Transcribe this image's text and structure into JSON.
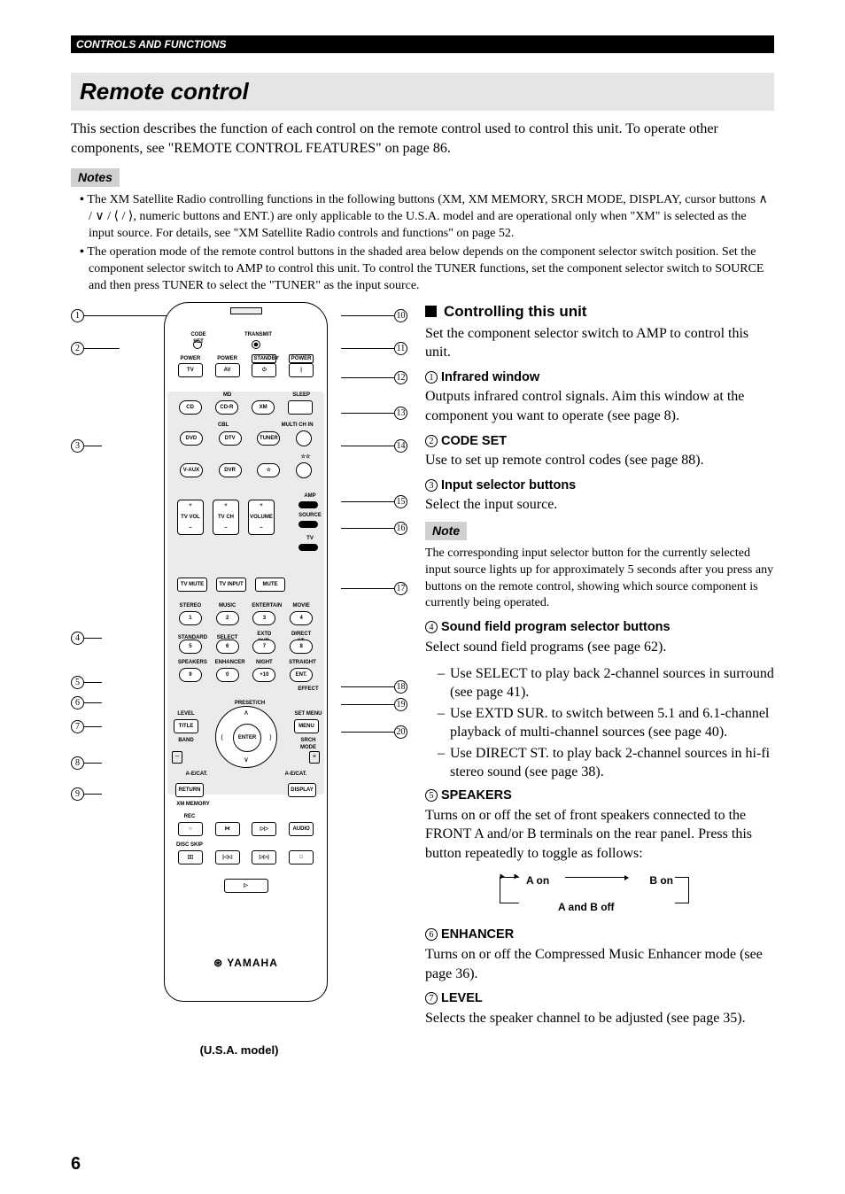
{
  "header_bar": "CONTROLS AND FUNCTIONS",
  "title": "Remote control",
  "intro": "This section describes the function of each control on the remote control used to control this unit. To operate other components, see \"REMOTE CONTROL FEATURES\" on page 86.",
  "notes_label": "Notes",
  "notes": [
    "The XM Satellite Radio controlling functions in the following buttons (XM, XM MEMORY, SRCH MODE, DISPLAY, cursor buttons ∧ / ∨ / ⟨ / ⟩, numeric buttons and ENT.) are only applicable to the U.S.A. model and are operational only when \"XM\" is selected as the input source. For details, see \"XM Satellite Radio controls and functions\" on page 52.",
    "The operation mode of the remote control buttons in the shaded area below depends on the component selector switch position. Set the component selector switch to AMP to control this unit. To control the TUNER functions, set the component selector switch to SOURCE and then press TUNER to select the \"TUNER\" as the input source."
  ],
  "remote": {
    "ir": "",
    "row_codeset": {
      "l": "CODE SET",
      "r": "TRANSMIT"
    },
    "row_power_hdr": [
      "POWER",
      "POWER",
      "STANDBY",
      "POWER"
    ],
    "row_power": [
      "TV",
      "AV",
      "⏻",
      "|"
    ],
    "row_src1_hdr": [
      "",
      "MD",
      "",
      "SLEEP"
    ],
    "row_src1": [
      "CD",
      "CD-R",
      "XM",
      ""
    ],
    "row_src2_hdr": [
      "",
      "CBL",
      "",
      "MULTI CH IN"
    ],
    "row_src2": [
      "DVD",
      "DTV",
      "TUNER",
      ""
    ],
    "row_src3": [
      "V-AUX",
      "DVR",
      "☆",
      ""
    ],
    "row_src3_icon": "☆☆",
    "sel_labels": [
      "AMP",
      "SOURCE",
      "TV"
    ],
    "big_btns": [
      {
        "top": "+",
        "mid": "TV VOL",
        "bot": "–"
      },
      {
        "top": "+",
        "mid": "TV CH",
        "bot": "–"
      },
      {
        "top": "+",
        "mid": "VOLUME",
        "bot": "–"
      }
    ],
    "row_mute": [
      "TV MUTE",
      "TV INPUT",
      "MUTE"
    ],
    "sf_headers1": [
      "STEREO",
      "MUSIC",
      "ENTERTAIN",
      "MOVIE"
    ],
    "sf_row1": [
      "1",
      "2",
      "3",
      "4"
    ],
    "sf_headers2": [
      "STANDARD",
      "SELECT",
      "EXTD SUR.",
      "DIRECT ST."
    ],
    "sf_row2": [
      "5",
      "6",
      "7",
      "8"
    ],
    "sf_headers3": [
      "SPEAKERS",
      "ENHANCER",
      "NIGHT",
      "STRAIGHT"
    ],
    "sf_row3": [
      "9",
      "0",
      "+10",
      "ENT."
    ],
    "effect_lbl": "EFFECT",
    "preset_lbl": "PRESET/CH",
    "dpad": {
      "center": "ENTER",
      "up": "∧",
      "down": "∨",
      "left": "⟨",
      "right": "⟩"
    },
    "left_col_lbls": [
      "LEVEL",
      "TITLE",
      "BAND"
    ],
    "right_col_lbls": [
      "SET MENU",
      "MENU",
      "SRCH MODE"
    ],
    "minus": "–",
    "plus": "+",
    "aecat_l": "A-E/CAT.",
    "aecat_r": "A-E/CAT.",
    "return_btn": "RETURN",
    "display_btn": "DISPLAY",
    "xm_mem": "XM MEMORY",
    "trans_row1_hdr": [
      "REC",
      "",
      "",
      ""
    ],
    "trans_row1": [
      "○",
      "⋈",
      "▷▷",
      "AUDIO"
    ],
    "trans_row2_hdr": [
      "DISC SKIP",
      "",
      "",
      ""
    ],
    "trans_row2": [
      "▯▯",
      "|◁◁",
      "▷▷|",
      "□"
    ],
    "play": "▷",
    "brand": "YAMAHA",
    "caption": "(U.S.A. model)"
  },
  "callouts_left": [
    "1",
    "2",
    "3",
    "4",
    "5",
    "6",
    "7",
    "8",
    "9"
  ],
  "callouts_right": [
    "10",
    "11",
    "12",
    "13",
    "14",
    "15",
    "16",
    "17",
    "18",
    "19",
    "20"
  ],
  "rc": {
    "heading": "Controlling this unit",
    "intro": "Set the component selector switch to AMP to control this unit.",
    "items": [
      {
        "n": "1",
        "h": "Infrared window",
        "p": "Outputs infrared control signals. Aim this window at the component you want to operate (see page 8)."
      },
      {
        "n": "2",
        "h": "CODE SET",
        "p": "Use to set up remote control codes (see page 88)."
      },
      {
        "n": "3",
        "h": "Input selector buttons",
        "p": "Select the input source."
      },
      {
        "n": "4",
        "h": "Sound field program selector buttons",
        "p": "Select sound field programs (see page 62).",
        "sub": [
          "Use SELECT to play back 2-channel sources in surround (see page 41).",
          "Use EXTD SUR. to switch between 5.1 and 6.1-channel playback of multi-channel sources (see page 40).",
          "Use DIRECT ST. to play back 2-channel sources in hi-fi stereo sound (see page 38)."
        ]
      },
      {
        "n": "5",
        "h": "SPEAKERS",
        "p": "Turns on or off the set of front speakers connected to the FRONT A and/or B terminals on the rear panel. Press this button repeatedly to toggle as follows:"
      },
      {
        "n": "6",
        "h": "ENHANCER",
        "p": "Turns on or off the Compressed Music Enhancer mode (see page 36)."
      },
      {
        "n": "7",
        "h": "LEVEL",
        "p": "Selects the speaker channel to be adjusted (see page 35)."
      }
    ],
    "note_label": "Note",
    "note_text": "The corresponding input selector button for the currently selected input source lights up for approximately 5 seconds after you press any buttons on the remote control, showing which source component is currently being operated.",
    "toggle": {
      "a": "A on",
      "b": "B on",
      "ab": "A and B off"
    }
  },
  "page_number": "6"
}
